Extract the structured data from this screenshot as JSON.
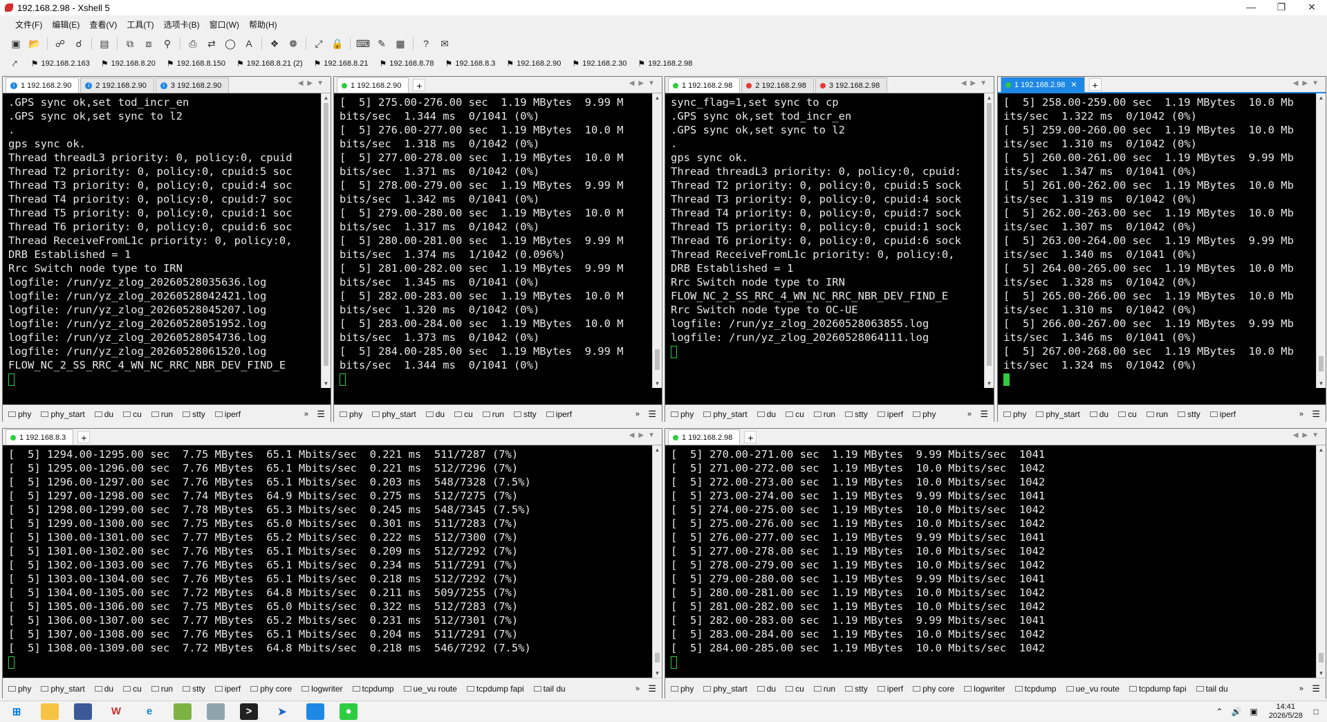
{
  "window": {
    "title": "192.168.2.98 - Xshell 5"
  },
  "menu": [
    "文件(F)",
    "编辑(E)",
    "查看(V)",
    "工具(T)",
    "选项卡(B)",
    "窗口(W)",
    "帮助(H)"
  ],
  "links": [
    "192.168.2.163",
    "192.168.8.20",
    "192.168.8.150",
    "192.168.8.21 (2)",
    "192.168.8.21",
    "192.168.8.78",
    "192.168.8.3",
    "192.168.2.90",
    "192.168.2.30",
    "192.168.2.98"
  ],
  "panes": [
    {
      "tabs": [
        {
          "label": "1 192.168.2.90",
          "icon": "info"
        },
        {
          "label": "2 192.168.2.90",
          "icon": "info"
        },
        {
          "label": "3 192.168.2.90",
          "icon": "info"
        }
      ],
      "lines": [
        ".GPS sync ok,set tod_incr_en",
        ".GPS sync ok,set sync to l2",
        ".",
        "gps sync ok.",
        "Thread threadL3 priority: 0, policy:0, cpuid",
        "Thread T2 priority: 0, policy:0, cpuid:5 soc",
        "Thread T3 priority: 0, policy:0, cpuid:4 soc",
        "Thread T4 priority: 0, policy:0, cpuid:7 soc",
        "Thread T5 priority: 0, policy:0, cpuid:1 soc",
        "Thread T6 priority: 0, policy:0, cpuid:6 soc",
        "Thread ReceiveFromL1c priority: 0, policy:0,",
        "DRB Established = 1",
        "Rrc Switch node type to IRN",
        "logfile: /run/yz_zlog_20260528035636.log",
        "logfile: /run/yz_zlog_20260528042421.log",
        "logfile: /run/yz_zlog_20260528045207.log",
        "logfile: /run/yz_zlog_20260528051952.log",
        "logfile: /run/yz_zlog_20260528054736.log",
        "logfile: /run/yz_zlog_20260528061520.log",
        "FLOW_NC_2_SS_RRC_4_WN_NC_RRC_NBR_DEV_FIND_E"
      ]
    },
    {
      "tabs": [
        {
          "label": "1 192.168.2.90",
          "icon": "green"
        }
      ],
      "lines": [
        "[  5] 275.00-276.00 sec  1.19 MBytes  9.99 M",
        "bits/sec  1.344 ms  0/1041 (0%)",
        "[  5] 276.00-277.00 sec  1.19 MBytes  10.0 M",
        "bits/sec  1.318 ms  0/1042 (0%)",
        "[  5] 277.00-278.00 sec  1.19 MBytes  10.0 M",
        "bits/sec  1.371 ms  0/1042 (0%)",
        "[  5] 278.00-279.00 sec  1.19 MBytes  9.99 M",
        "bits/sec  1.342 ms  0/1041 (0%)",
        "[  5] 279.00-280.00 sec  1.19 MBytes  10.0 M",
        "bits/sec  1.317 ms  0/1042 (0%)",
        "[  5] 280.00-281.00 sec  1.19 MBytes  9.99 M",
        "bits/sec  1.374 ms  1/1042 (0.096%)",
        "[  5] 281.00-282.00 sec  1.19 MBytes  9.99 M",
        "bits/sec  1.345 ms  0/1041 (0%)",
        "[  5] 282.00-283.00 sec  1.19 MBytes  10.0 M",
        "bits/sec  1.320 ms  0/1042 (0%)",
        "[  5] 283.00-284.00 sec  1.19 MBytes  10.0 M",
        "bits/sec  1.373 ms  0/1042 (0%)",
        "[  5] 284.00-285.00 sec  1.19 MBytes  9.99 M",
        "bits/sec  1.344 ms  0/1041 (0%)"
      ]
    },
    {
      "tabs": [
        {
          "label": "1 192.168.2.98",
          "icon": "green"
        },
        {
          "label": "2 192.168.2.98",
          "icon": "red"
        },
        {
          "label": "3 192.168.2.98",
          "icon": "red"
        }
      ],
      "lines": [
        "sync_flag=1,set sync to cp",
        ".GPS sync ok,set tod_incr_en",
        ".GPS sync ok,set sync to l2",
        ".",
        "gps sync ok.",
        "Thread threadL3 priority: 0, policy:0, cpuid:",
        "Thread T2 priority: 0, policy:0, cpuid:5 sock",
        "Thread T3 priority: 0, policy:0, cpuid:4 sock",
        "Thread T4 priority: 0, policy:0, cpuid:7 sock",
        "Thread T5 priority: 0, policy:0, cpuid:1 sock",
        "Thread T6 priority: 0, policy:0, cpuid:6 sock",
        "Thread ReceiveFromL1c priority: 0, policy:0,",
        "DRB Established = 1",
        "Rrc Switch node type to IRN",
        "FLOW_NC_2_SS_RRC_4_WN_NC_RRC_NBR_DEV_FIND_E",
        "Rrc Switch node type to OC-UE",
        "logfile: /run/yz_zlog_20260528063855.log",
        "logfile: /run/yz_zlog_20260528064111.log"
      ]
    },
    {
      "tabs": [
        {
          "label": "1 192.168.2.98",
          "icon": "green"
        }
      ],
      "lines": [
        "[  5] 258.00-259.00 sec  1.19 MBytes  10.0 Mb",
        "its/sec  1.322 ms  0/1042 (0%)",
        "[  5] 259.00-260.00 sec  1.19 MBytes  10.0 Mb",
        "its/sec  1.310 ms  0/1042 (0%)",
        "[  5] 260.00-261.00 sec  1.19 MBytes  9.99 Mb",
        "its/sec  1.347 ms  0/1041 (0%)",
        "[  5] 261.00-262.00 sec  1.19 MBytes  10.0 Mb",
        "its/sec  1.319 ms  0/1042 (0%)",
        "[  5] 262.00-263.00 sec  1.19 MBytes  10.0 Mb",
        "its/sec  1.307 ms  0/1042 (0%)",
        "[  5] 263.00-264.00 sec  1.19 MBytes  9.99 Mb",
        "its/sec  1.340 ms  0/1041 (0%)",
        "[  5] 264.00-265.00 sec  1.19 MBytes  10.0 Mb",
        "its/sec  1.328 ms  0/1042 (0%)",
        "[  5] 265.00-266.00 sec  1.19 MBytes  10.0 Mb",
        "its/sec  1.310 ms  0/1042 (0%)",
        "[  5] 266.00-267.00 sec  1.19 MBytes  9.99 Mb",
        "its/sec  1.346 ms  0/1041 (0%)",
        "[  5] 267.00-268.00 sec  1.19 MBytes  10.0 Mb",
        "its/sec  1.324 ms  0/1042 (0%)"
      ]
    },
    {
      "tabs": [
        {
          "label": "1 192.168.8.3",
          "icon": "green"
        }
      ],
      "lines": [
        "[  5] 1294.00-1295.00 sec  7.75 MBytes  65.1 Mbits/sec  0.221 ms  511/7287 (7%)",
        "[  5] 1295.00-1296.00 sec  7.76 MBytes  65.1 Mbits/sec  0.221 ms  512/7296 (7%)",
        "[  5] 1296.00-1297.00 sec  7.76 MBytes  65.1 Mbits/sec  0.203 ms  548/7328 (7.5%)",
        "[  5] 1297.00-1298.00 sec  7.74 MBytes  64.9 Mbits/sec  0.275 ms  512/7275 (7%)",
        "[  5] 1298.00-1299.00 sec  7.78 MBytes  65.3 Mbits/sec  0.245 ms  548/7345 (7.5%)",
        "[  5] 1299.00-1300.00 sec  7.75 MBytes  65.0 Mbits/sec  0.301 ms  511/7283 (7%)",
        "[  5] 1300.00-1301.00 sec  7.77 MBytes  65.2 Mbits/sec  0.222 ms  512/7300 (7%)",
        "[  5] 1301.00-1302.00 sec  7.76 MBytes  65.1 Mbits/sec  0.209 ms  512/7292 (7%)",
        "[  5] 1302.00-1303.00 sec  7.76 MBytes  65.1 Mbits/sec  0.234 ms  511/7291 (7%)",
        "[  5] 1303.00-1304.00 sec  7.76 MBytes  65.1 Mbits/sec  0.218 ms  512/7292 (7%)",
        "[  5] 1304.00-1305.00 sec  7.72 MBytes  64.8 Mbits/sec  0.211 ms  509/7255 (7%)",
        "[  5] 1305.00-1306.00 sec  7.75 MBytes  65.0 Mbits/sec  0.322 ms  512/7283 (7%)",
        "[  5] 1306.00-1307.00 sec  7.77 MBytes  65.2 Mbits/sec  0.231 ms  512/7301 (7%)",
        "[  5] 1307.00-1308.00 sec  7.76 MBytes  65.1 Mbits/sec  0.204 ms  511/7291 (7%)",
        "[  5] 1308.00-1309.00 sec  7.72 MBytes  64.8 Mbits/sec  0.218 ms  546/7292 (7.5%)"
      ]
    },
    {
      "tabs": [
        {
          "label": "1 192.168.2.98",
          "icon": "green"
        }
      ],
      "lines": [
        "[  5] 270.00-271.00 sec  1.19 MBytes  9.99 Mbits/sec  1041",
        "[  5] 271.00-272.00 sec  1.19 MBytes  10.0 Mbits/sec  1042",
        "[  5] 272.00-273.00 sec  1.19 MBytes  10.0 Mbits/sec  1042",
        "[  5] 273.00-274.00 sec  1.19 MBytes  9.99 Mbits/sec  1041",
        "[  5] 274.00-275.00 sec  1.19 MBytes  10.0 Mbits/sec  1042",
        "[  5] 275.00-276.00 sec  1.19 MBytes  10.0 Mbits/sec  1042",
        "[  5] 276.00-277.00 sec  1.19 MBytes  9.99 Mbits/sec  1041",
        "[  5] 277.00-278.00 sec  1.19 MBytes  10.0 Mbits/sec  1042",
        "[  5] 278.00-279.00 sec  1.19 MBytes  10.0 Mbits/sec  1042",
        "[  5] 279.00-280.00 sec  1.19 MBytes  9.99 Mbits/sec  1041",
        "[  5] 280.00-281.00 sec  1.19 MBytes  10.0 Mbits/sec  1042",
        "[  5] 281.00-282.00 sec  1.19 MBytes  10.0 Mbits/sec  1042",
        "[  5] 282.00-283.00 sec  1.19 MBytes  9.99 Mbits/sec  1041",
        "[  5] 283.00-284.00 sec  1.19 MBytes  10.0 Mbits/sec  1042",
        "[  5] 284.00-285.00 sec  1.19 MBytes  10.0 Mbits/sec  1042"
      ]
    }
  ],
  "quickbar": {
    "short": [
      "phy",
      "phy_start",
      "du",
      "cu",
      "run",
      "stty",
      "iperf"
    ],
    "pane3": [
      "phy",
      "phy_start",
      "du",
      "cu",
      "run",
      "stty",
      "iperf",
      "phy"
    ],
    "long": [
      "phy",
      "phy_start",
      "du",
      "cu",
      "run",
      "stty",
      "iperf",
      "phy core",
      "logwriter",
      "tcpdump",
      "ue_vu route",
      "tcpdump fapi",
      "tail du"
    ]
  },
  "taskbar": {
    "time": "14:41",
    "date": "2026/5/28"
  },
  "colors": {
    "green": "#2ecc40",
    "red": "#e53935",
    "info": "#1e88e5"
  }
}
